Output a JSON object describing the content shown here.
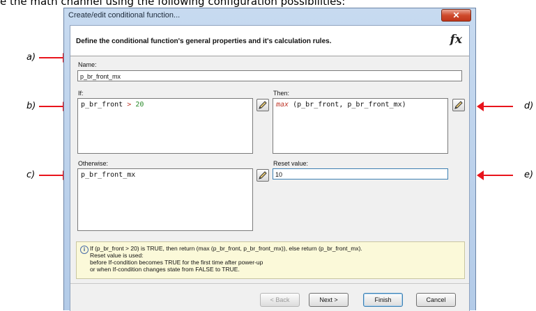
{
  "doc_text": "e the math channel using the following configuration possibilities:",
  "annotations": {
    "a": "a)",
    "b": "b)",
    "c": "c)",
    "d": "d)",
    "e": "e)"
  },
  "window": {
    "title": "Create/edit conditional function...",
    "close_glyph": "✕",
    "header": "Define the conditional function's general properties and it's calculation rules.",
    "fx_glyph": "fx"
  },
  "form": {
    "name_label": "Name:",
    "name_value": "p_br_front_mx",
    "if_label": "If:",
    "if_parts": {
      "var": "p_br_front",
      "op": ">",
      "num": "20"
    },
    "then_label": "Then:",
    "then_parts": {
      "fn": "max",
      "args": "(p_br_front, p_br_front_mx)"
    },
    "otherwise_label": "Otherwise:",
    "otherwise_value": "p_br_front_mx",
    "reset_label": "Reset value:",
    "reset_value": "10"
  },
  "info": {
    "icon_glyph": "i",
    "lines": [
      "If (p_br_front > 20) is TRUE, then return (max (p_br_front, p_br_front_mx)), else return (p_br_front_mx).",
      "Reset value is used:",
      "before If-condition becomes TRUE for the first time after power-up",
      "or when If-condition changes state from FALSE to TRUE."
    ]
  },
  "buttons": {
    "back": "< Back",
    "next": "Next >",
    "finish": "Finish",
    "cancel": "Cancel"
  },
  "colors": {
    "arrow": "#e8141c",
    "keyword": "#c0392b",
    "number": "#2a8a2a"
  }
}
